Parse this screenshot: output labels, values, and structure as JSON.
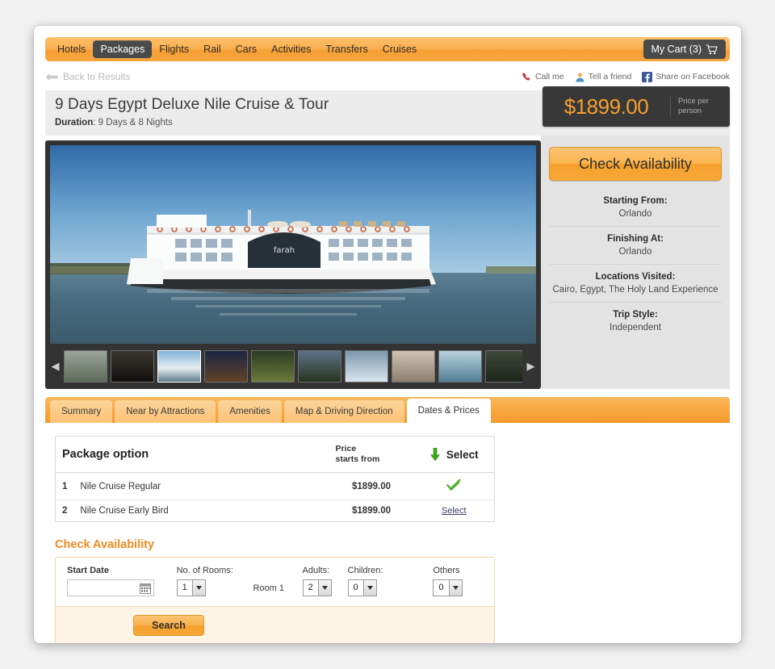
{
  "nav": {
    "items": [
      {
        "label": "Hotels",
        "active": false
      },
      {
        "label": "Packages",
        "active": true
      },
      {
        "label": "Flights",
        "active": false
      },
      {
        "label": "Rail",
        "active": false
      },
      {
        "label": "Cars",
        "active": false
      },
      {
        "label": "Activities",
        "active": false
      },
      {
        "label": "Transfers",
        "active": false
      },
      {
        "label": "Cruises",
        "active": false
      }
    ],
    "cart_label": "My Cart (3)"
  },
  "subbar": {
    "back_label": "Back to Results",
    "social": [
      {
        "label": "Call me",
        "icon": "phone-icon"
      },
      {
        "label": "Tell a friend",
        "icon": "person-icon"
      },
      {
        "label": "Share on Facebook",
        "icon": "facebook-icon"
      }
    ]
  },
  "product": {
    "title": "9 Days Egypt Deluxe Nile Cruise & Tour",
    "duration_label": "Duration",
    "duration_value": "9 Days & 8 Nights",
    "price": "$1899.00",
    "price_note": "Price per person"
  },
  "sidebar": {
    "check_availability_label": "Check Availability",
    "rows": [
      {
        "label": "Starting From:",
        "value": "Orlando"
      },
      {
        "label": "Finishing At:",
        "value": "Orlando"
      },
      {
        "label": "Locations Visited:",
        "value": "Cairo, Egypt, The Holy Land Experience"
      },
      {
        "label": "Trip Style:",
        "value": "Independent"
      }
    ]
  },
  "gallery": {
    "hero_alt": "Nile cruise ship M/S Farah on the river",
    "prev_icon": "◀",
    "next_icon": "▶",
    "thumb_count": 10,
    "active_thumb": 2
  },
  "tabs": [
    {
      "label": "Summary",
      "active": false
    },
    {
      "label": "Near by Attractions",
      "active": false
    },
    {
      "label": "Amenities",
      "active": false
    },
    {
      "label": "Map & Driving Direction",
      "active": false
    },
    {
      "label": "Dates & Prices",
      "active": true
    }
  ],
  "package_table": {
    "headers": {
      "option": "Package option",
      "price": "Price\nstarts from",
      "price_line1": "Price",
      "price_line2": "starts from",
      "select": "Select"
    },
    "rows": [
      {
        "num": "1",
        "name": "Nile Cruise Regular",
        "price": "$1899.00",
        "selected": true,
        "select_label": ""
      },
      {
        "num": "2",
        "name": "Nile Cruise Early Bird",
        "price": "$1899.00",
        "selected": false,
        "select_label": "Select"
      }
    ]
  },
  "availability_form": {
    "heading": "Check Availability",
    "start_date_label": "Start Date",
    "start_date_value": "",
    "start_date_placeholder": "",
    "rooms_label": "No. of Rooms:",
    "rooms_value": "1",
    "room_tag": "Room 1",
    "adults_label": "Adults:",
    "adults_value": "2",
    "children_label": "Children:",
    "children_value": "0",
    "others_label": "Others",
    "others_value": "0",
    "search_label": "Search"
  },
  "colors": {
    "orange": "#f6a02c",
    "orange_text": "#f08a1e",
    "dark": "#4a4a4a",
    "panel_gray": "#e3e3e3",
    "green": "#4caf27"
  }
}
